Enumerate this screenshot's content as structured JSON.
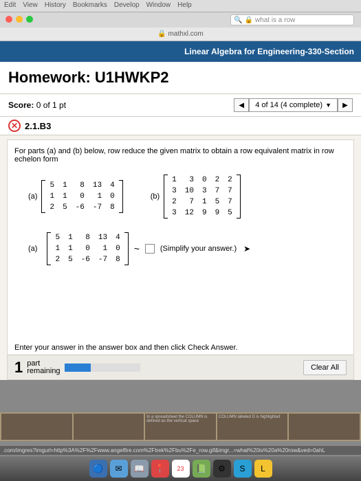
{
  "menubar": {
    "items": [
      "Edit",
      "View",
      "History",
      "Bookmarks",
      "Develop",
      "Window",
      "Help"
    ]
  },
  "search": {
    "placeholder": "what is a row"
  },
  "address": {
    "host": "mathxl.com"
  },
  "course": {
    "title": "Linear Algebra for Engineering-330-Section"
  },
  "homework": {
    "title": "Homework: U1HWKP2"
  },
  "score": {
    "label": "Score:",
    "value": "0 of 1 pt"
  },
  "nav": {
    "position": "4 of 14 (4 complete)"
  },
  "question": {
    "number": "2.1.B3"
  },
  "problem": {
    "prompt": "For parts (a) and (b) below, row reduce the given matrix to obtain a row equivalent matrix in row echelon form",
    "label_a": "(a)",
    "label_b": "(b)",
    "matrix_a": [
      [
        "5",
        "1",
        "8",
        "13",
        "4"
      ],
      [
        "1",
        "1",
        "0",
        "1",
        "0"
      ],
      [
        "2",
        "5",
        "-6",
        "-7",
        "8"
      ]
    ],
    "matrix_b": [
      [
        "1",
        "3",
        "0",
        "2",
        "2"
      ],
      [
        "3",
        "10",
        "3",
        "7",
        "7"
      ],
      [
        "2",
        "7",
        "1",
        "5",
        "7"
      ],
      [
        "3",
        "12",
        "9",
        "9",
        "5"
      ]
    ],
    "answer_label": "(a)",
    "answer_matrix": [
      [
        "5",
        "1",
        "8",
        "13",
        "4"
      ],
      [
        "1",
        "1",
        "0",
        "1",
        "0"
      ],
      [
        "2",
        "5",
        "-6",
        "-7",
        "8"
      ]
    ],
    "simplify": "(Simplify your answer.)",
    "enter": "Enter your answer in the answer box and then click Check Answer."
  },
  "footer": {
    "count": "1",
    "parts_label_top": "part",
    "parts_label_bot": "remaining",
    "clear": "Clear All"
  },
  "thumbs": {
    "t1": "In a spreadsheet the COLUMN is defined as the vertical space",
    "t2": "COLUMN labeled D is highlighted"
  },
  "status_url": ".com/imgres?imgurl=http%3A%2F%2Fwww.angelfire.com%2Ftrek%2Fbu%2Fe_row.gif&imgr...=what%20is%20a%20row&ved=0ahL"
}
